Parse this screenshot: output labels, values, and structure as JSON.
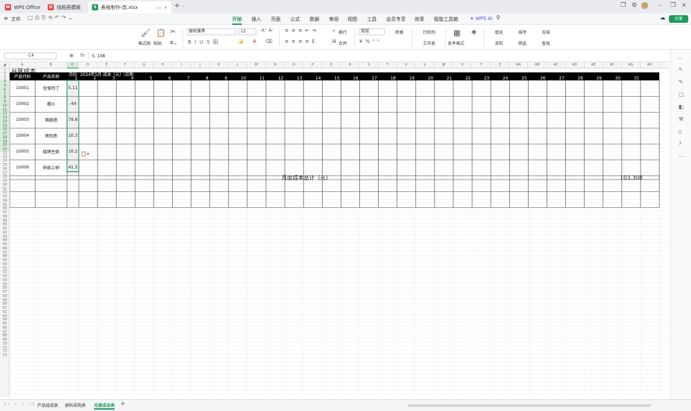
{
  "tabs": [
    {
      "label": "WPS Office",
      "icon": "W",
      "color": "#d83b3b"
    },
    {
      "label": "找稻壳模板",
      "icon": "D",
      "color": "#e8473c"
    },
    {
      "label": "表格制作-改.xlsx",
      "icon": "S",
      "color": "#1b9a5c"
    }
  ],
  "file_menu": "文件",
  "menus": [
    "开始",
    "插入",
    "页面",
    "公式",
    "数据",
    "审阅",
    "视图",
    "工具",
    "会员专享",
    "效率",
    "智能工具箱"
  ],
  "wps_ai": "WPS AI",
  "share": "分享",
  "ribbon": {
    "format_painter": "格式刷",
    "paste": "粘贴",
    "font_name": "微软雅黑",
    "font_size": "12",
    "wrap": "换行",
    "merge": "合并",
    "number_format": "常规",
    "convert": "转换",
    "rowcol": "行和列",
    "worksheet": "工作表",
    "cond_format": "条件格式",
    "fill": "填充",
    "sort": "排序",
    "freeze": "冻结",
    "sum": "求和",
    "filter": "筛选",
    "find": "查找"
  },
  "formula_bar": {
    "cell_ref": "C4",
    "fx": "fx",
    "value": "5. 108"
  },
  "columns": [
    "A",
    "B",
    "C",
    "D",
    "E",
    "F",
    "G",
    "H",
    "I",
    "J",
    "K",
    "L",
    "M",
    "N",
    "O",
    "P",
    "Q",
    "R",
    "S",
    "T",
    "U",
    "V",
    "W",
    "X",
    "Y",
    "Z",
    "AA",
    "AB",
    "AC",
    "AD",
    "AE",
    "AF",
    "AG",
    "AH"
  ],
  "rows": [
    "1",
    "2",
    "3",
    "4",
    "5",
    "6",
    "7",
    "8",
    "9",
    "10",
    "11",
    "12",
    "13",
    "14",
    "15",
    "16",
    "17",
    "18",
    "19",
    "20",
    "21",
    "22",
    "23",
    "24",
    "25",
    "26",
    "27",
    "28",
    "29",
    "30",
    "31",
    "32",
    "33",
    "34",
    "35",
    "36",
    "37",
    "38",
    "39",
    "40",
    "41",
    "42",
    "43",
    "44",
    "45",
    "46",
    "47",
    "48",
    "49",
    "50",
    "51",
    "52",
    "53",
    "54",
    "55",
    "56",
    "57",
    "58",
    "59",
    "60",
    "61",
    "62",
    "63",
    "64",
    "65",
    "66",
    "67",
    "68",
    "69",
    "70",
    "71",
    "72",
    "73"
  ],
  "sheet": {
    "title": "月度成本",
    "header_code": "产品代码",
    "header_name": "产品名称",
    "header_month": "月份",
    "header_date": "2024年5月  成本（元）\\日期",
    "days": [
      "1",
      "2",
      "3",
      "4",
      "5",
      "6",
      "7",
      "8",
      "9",
      "10",
      "11",
      "12",
      "13",
      "14",
      "15",
      "16",
      "17",
      "18",
      "19",
      "20",
      "21",
      "22",
      "23",
      "24",
      "25",
      "26",
      "27",
      "28",
      "29",
      "30",
      "31"
    ],
    "products": [
      {
        "code": "10001",
        "name": "宫保鸡丁",
        "value": "5.11"
      },
      {
        "code": "10002",
        "name": "椰汁",
        "value": "-44"
      },
      {
        "code": "10003",
        "name": "佛跳墙",
        "value": "79.8"
      },
      {
        "code": "10004",
        "name": "烤肉串",
        "value": "10.3"
      },
      {
        "code": "10005",
        "name": "碳烤生蚝",
        "value": "10.2"
      },
      {
        "code": "10006",
        "name": "蚂蚁上树",
        "value": "41.5"
      }
    ],
    "total_label": "月度成本总计（元）",
    "total_value": "103.308"
  },
  "sheet_tabs": [
    "产品组成表",
    "原料采购表",
    "月度成本表"
  ],
  "active_sheet": "月度成本表"
}
